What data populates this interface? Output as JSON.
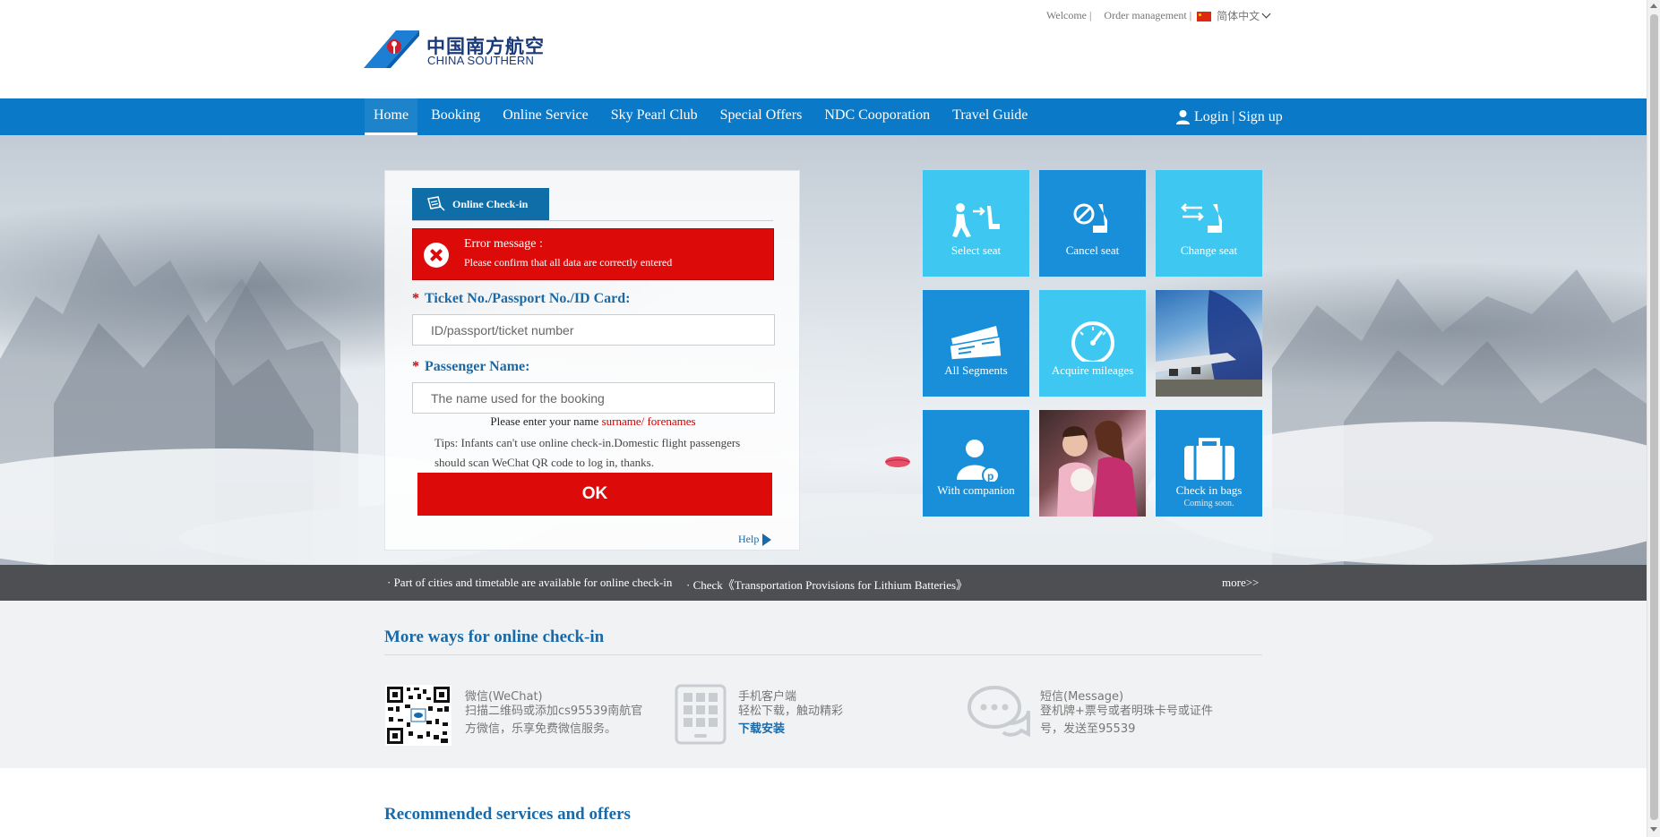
{
  "header": {
    "links": {
      "welcome": "Welcome |",
      "order": "Order management |",
      "language": "简体中文"
    },
    "logo": {
      "cn": "中国南方航空",
      "en": "CHINA SOUTHERN"
    }
  },
  "nav": {
    "items": [
      "Home",
      "Booking",
      "Online Service",
      "Sky Pearl Club",
      "Special Offers",
      "NDC Cooporation",
      "Travel Guide"
    ],
    "active": "Home",
    "login": "Login | Sign up"
  },
  "checkin": {
    "tab_label": "Online Check-in",
    "error": {
      "title": "Error message :",
      "message": "Please confirm that all data are correctly entered"
    },
    "ticket_label": "Ticket No./Passport No./ID Card:",
    "ticket_placeholder": "ID/passport/ticket number",
    "name_label": "Passenger Name:",
    "name_placeholder": "The name used for the booking",
    "required_mark": "*",
    "name_hint": "Please enter your name",
    "name_hint_red": "surname/ forenames",
    "tips": "Tips: Infants can't use online check-in.Domestic flight passengers should scan WeChat QR code to log in, thanks.",
    "ok_label": "OK",
    "help_label": "Help"
  },
  "tiles": {
    "select_seat": "Select seat",
    "cancel_seat": "Cancel seat",
    "change_seat": "Change seat",
    "all_segments": "All Segments",
    "acquire_mileages": "Acquire mileages",
    "with_companion": "With companion",
    "check_in_bags": "Check in bags",
    "coming_soon": "Coming soon."
  },
  "ticker": {
    "item1": "· Part of cities and timetable are available for online check-in",
    "item2": "· Check《Transportation Provisions for Lithium Batteries》",
    "more": "more>>"
  },
  "more_ways": {
    "title": "More ways for online check-in",
    "wechat": {
      "title": "微信(WeChat)",
      "text": "扫描二维码或添加cs95539南航官方微信，乐享免费微信服务。"
    },
    "app": {
      "title": "手机客户端",
      "text": "轻松下载，触动精彩",
      "link": "下载安装"
    },
    "sms": {
      "title": "短信(Message)",
      "text": "登机牌+票号或者明珠卡号或证件号，发送至95539"
    }
  },
  "recommended": {
    "title": "Recommended services and offers"
  },
  "colors": {
    "nav_blue": "#0a7ac8",
    "error_red": "#dd0a0a",
    "tile_light": "#3ec7f0",
    "tile_dark": "#1a8fd9",
    "heading_blue": "#1a6aa8"
  }
}
